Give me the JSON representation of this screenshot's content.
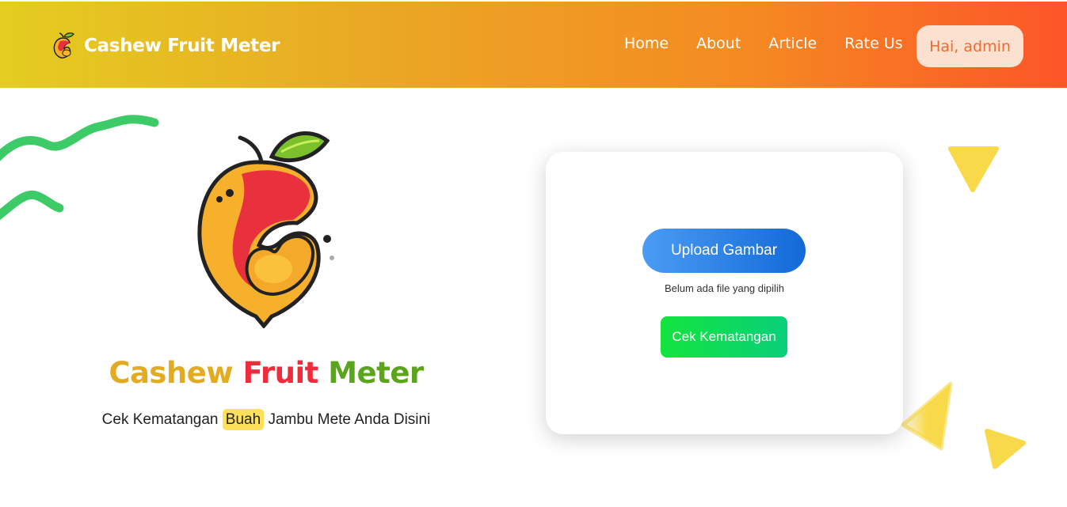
{
  "navbar": {
    "brand": "Cashew Fruit Meter",
    "links": [
      "Home",
      "About",
      "Article",
      "Rate Us"
    ],
    "user_button": "Hai, admin"
  },
  "hero": {
    "title_part1": "Cashew",
    "title_part2": "Fruit",
    "title_part3": "Meter",
    "subtitle_before": "Cek Kematangan",
    "subtitle_highlight": "Buah",
    "subtitle_after": "Jambu Mete Anda Disini"
  },
  "upload_card": {
    "upload_label": "Upload Gambar",
    "file_status": "Belum ada file yang dipilih",
    "check_label": "Cek Kematangan"
  },
  "colors": {
    "nav_gradient_start": "#e4cd20",
    "nav_gradient_end": "#fd5528",
    "title_cashew": "#e2ab22",
    "title_fruit": "#ef2b3c",
    "title_meter": "#5aa51b",
    "upload_blue": "#136ad8",
    "check_green": "#13e43e",
    "highlight_yellow": "#ffe05a"
  }
}
